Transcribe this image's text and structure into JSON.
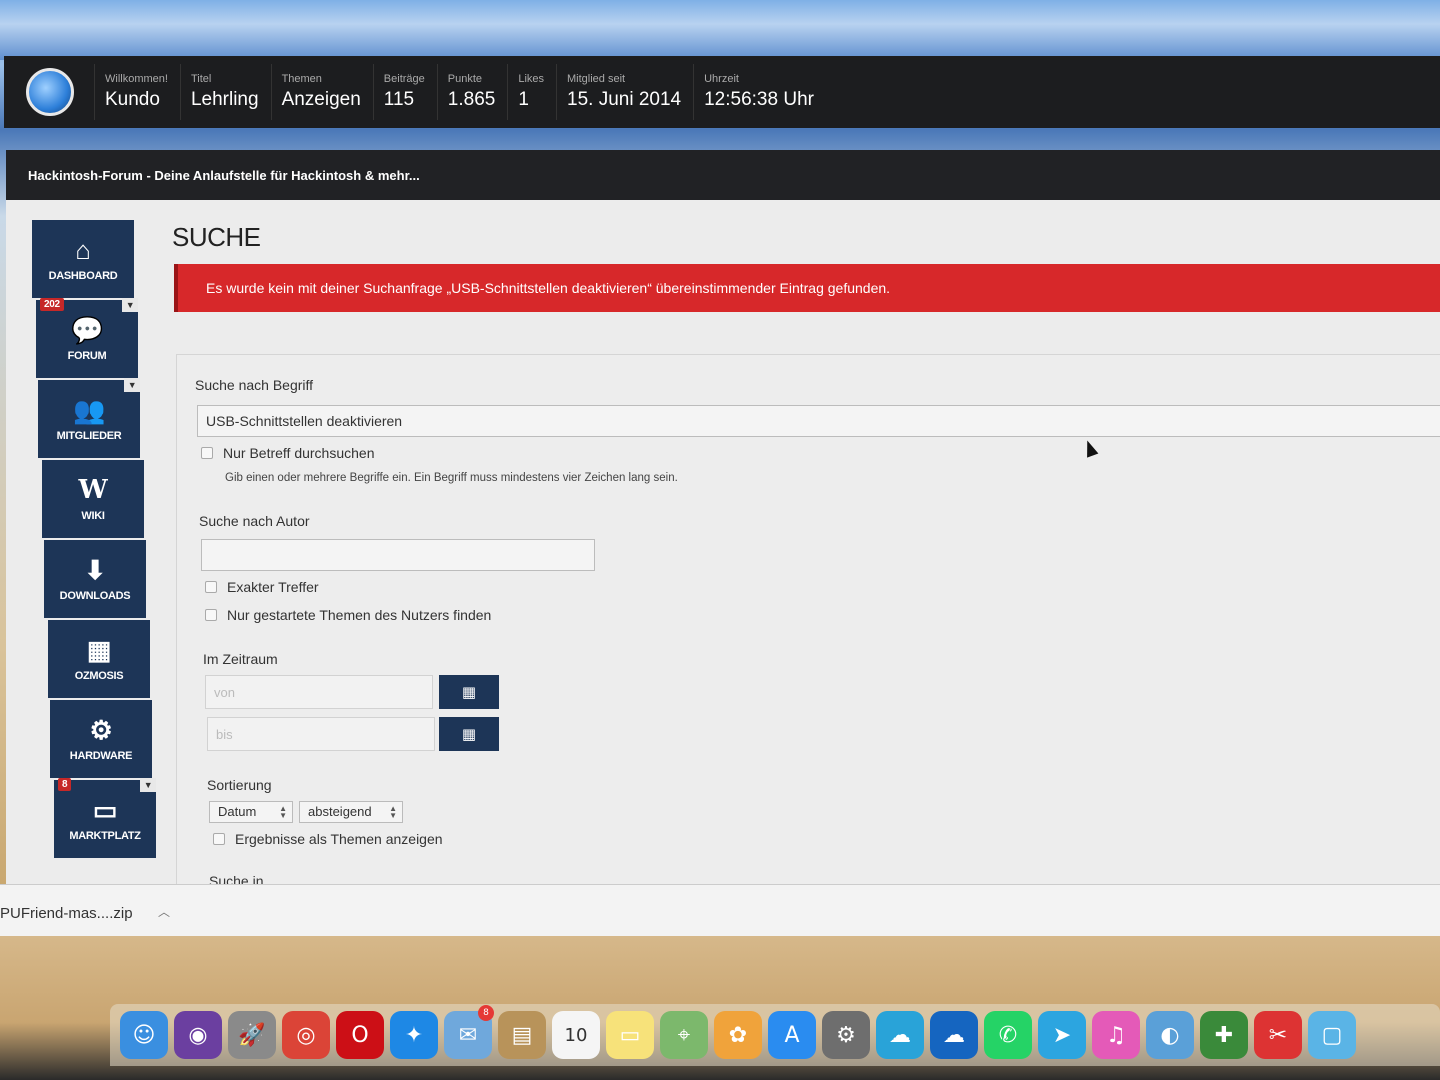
{
  "userbar": {
    "welcome_label": "Willkommen!",
    "username": "Kundo",
    "stats": [
      {
        "label": "Titel",
        "value": "Lehrling"
      },
      {
        "label": "Themen",
        "value": "Anzeigen"
      },
      {
        "label": "Beiträge",
        "value": "115"
      },
      {
        "label": "Punkte",
        "value": "1.865"
      },
      {
        "label": "Likes",
        "value": "1"
      },
      {
        "label": "Mitglied seit",
        "value": "15. Juni 2014"
      },
      {
        "label": "Uhrzeit",
        "value": "12:56:38 Uhr"
      }
    ]
  },
  "site_title": "Hackintosh-Forum - Deine Anlaufstelle für Hackintosh & mehr...",
  "sidebar": {
    "items": [
      {
        "label": "DASHBOARD",
        "icon": "home-icon",
        "glyph": "⌂"
      },
      {
        "label": "FORUM",
        "icon": "chat-icon",
        "glyph": "💬",
        "badge": "202"
      },
      {
        "label": "MITGLIEDER",
        "icon": "users-icon",
        "glyph": "👥"
      },
      {
        "label": "WIKI",
        "icon": "wiki-icon",
        "glyph": "W"
      },
      {
        "label": "DOWNLOADS",
        "icon": "download-icon",
        "glyph": "⬇"
      },
      {
        "label": "OZMOSIS",
        "icon": "chip-icon",
        "glyph": "▦"
      },
      {
        "label": "HARDWARE",
        "icon": "gears-icon",
        "glyph": "⚙"
      },
      {
        "label": "MARKTPLATZ",
        "icon": "card-icon",
        "glyph": "▭",
        "badge": "8"
      }
    ]
  },
  "page_title": "SUCHE",
  "alert_text": "Es wurde kein mit deiner Suchanfrage „USB-Schnittstellen deaktivieren“ übereinstimmender Eintrag gefunden.",
  "form": {
    "term_label": "Suche nach Begriff",
    "term_value": "USB-Schnittstellen deaktivieren",
    "subject_only_label": "Nur Betreff durchsuchen",
    "term_hint": "Gib einen oder mehrere Begriffe ein. Ein Begriff muss mindestens vier Zeichen lang sein.",
    "author_label": "Suche nach Autor",
    "author_value": "",
    "exact_label": "Exakter Treffer",
    "started_threads_label": "Nur gestartete Themen des Nutzers finden",
    "period_label": "Im Zeitraum",
    "from_placeholder": "von",
    "to_placeholder": "bis",
    "sort_label": "Sortierung",
    "sort_field": "Datum",
    "sort_order": "absteigend",
    "show_threads_label": "Ergebnisse als Themen anzeigen",
    "search_in_label": "Suche in"
  },
  "download_bar": {
    "file_name": "PUFriend-mas....zip"
  },
  "dock": {
    "items": [
      {
        "name": "finder-icon",
        "glyph": "☺",
        "color": "#3a8fe0"
      },
      {
        "name": "siri-icon",
        "glyph": "◉",
        "color": "#6b3fa0"
      },
      {
        "name": "launchpad-icon",
        "glyph": "🚀",
        "color": "#8a8a8a"
      },
      {
        "name": "chrome-icon",
        "glyph": "◎",
        "color": "#db4437"
      },
      {
        "name": "opera-icon",
        "glyph": "O",
        "color": "#cc0f16"
      },
      {
        "name": "safari-icon",
        "glyph": "✦",
        "color": "#1e88e5"
      },
      {
        "name": "mail-icon",
        "glyph": "✉",
        "color": "#6fa8dc",
        "badge": "8"
      },
      {
        "name": "contacts-icon",
        "glyph": "▤",
        "color": "#b8935a"
      },
      {
        "name": "calendar-icon",
        "glyph": "10",
        "color": "#f5f5f5"
      },
      {
        "name": "notes-icon",
        "glyph": "▭",
        "color": "#f7e27a"
      },
      {
        "name": "maps-icon",
        "glyph": "⌖",
        "color": "#7cb86c"
      },
      {
        "name": "photos-icon",
        "glyph": "✿",
        "color": "#f0a33b"
      },
      {
        "name": "appstore-icon",
        "glyph": "A",
        "color": "#2a8cf0"
      },
      {
        "name": "system-preferences-icon",
        "glyph": "⚙",
        "color": "#6e6e6e"
      },
      {
        "name": "vpn-cloud-icon",
        "glyph": "☁",
        "color": "#29a3d8"
      },
      {
        "name": "onedrive-icon",
        "glyph": "☁",
        "color": "#1565c0"
      },
      {
        "name": "whatsapp-icon",
        "glyph": "✆",
        "color": "#25d366"
      },
      {
        "name": "telegram-icon",
        "glyph": "➤",
        "color": "#2ca5e0"
      },
      {
        "name": "itunes-icon",
        "glyph": "♫",
        "color": "#e45ab8"
      },
      {
        "name": "preview-icon",
        "glyph": "◐",
        "color": "#5aa0d8"
      },
      {
        "name": "utility-icon",
        "glyph": "✚",
        "color": "#3a8a3a"
      },
      {
        "name": "tool-icon",
        "glyph": "✂",
        "color": "#d33"
      },
      {
        "name": "downloads-folder-icon",
        "glyph": "▢",
        "color": "#5ab4e6"
      }
    ]
  }
}
